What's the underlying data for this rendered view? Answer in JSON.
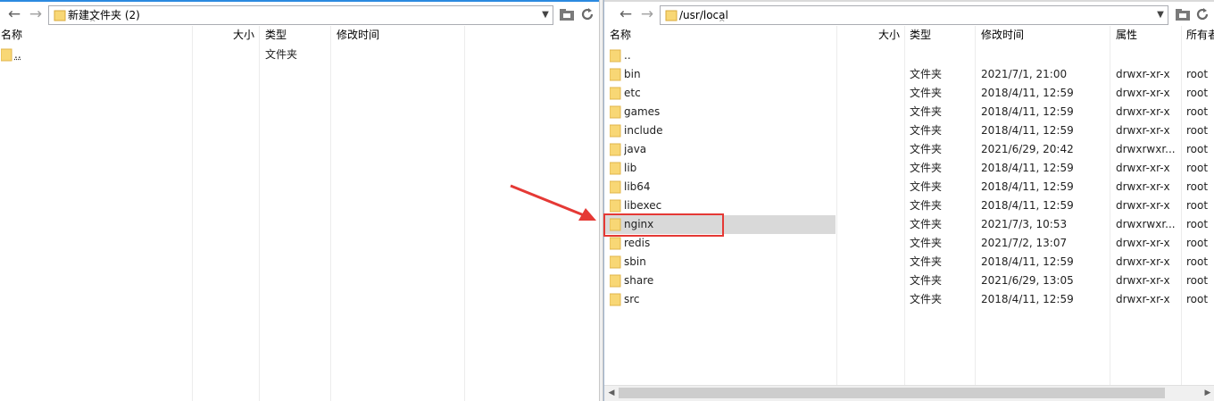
{
  "left_pane": {
    "address": "新建文件夹 (2)",
    "columns": [
      "名称",
      "大小",
      "类型",
      "修改时间"
    ],
    "rows": [
      {
        "name": "..",
        "size": "",
        "type": "文件夹",
        "modified": ""
      }
    ]
  },
  "right_pane": {
    "address": "/usr/local",
    "columns": [
      "名称",
      "大小",
      "类型",
      "修改时间",
      "属性",
      "所有者"
    ],
    "rows": [
      {
        "name": "..",
        "type": "",
        "modified": "",
        "attr": "",
        "owner": ""
      },
      {
        "name": "bin",
        "type": "文件夹",
        "modified": "2021/7/1, 21:00",
        "attr": "drwxr-xr-x",
        "owner": "root"
      },
      {
        "name": "etc",
        "type": "文件夹",
        "modified": "2018/4/11, 12:59",
        "attr": "drwxr-xr-x",
        "owner": "root"
      },
      {
        "name": "games",
        "type": "文件夹",
        "modified": "2018/4/11, 12:59",
        "attr": "drwxr-xr-x",
        "owner": "root"
      },
      {
        "name": "include",
        "type": "文件夹",
        "modified": "2018/4/11, 12:59",
        "attr": "drwxr-xr-x",
        "owner": "root"
      },
      {
        "name": "java",
        "type": "文件夹",
        "modified": "2021/6/29, 20:42",
        "attr": "drwxrwxr...",
        "owner": "root"
      },
      {
        "name": "lib",
        "type": "文件夹",
        "modified": "2018/4/11, 12:59",
        "attr": "drwxr-xr-x",
        "owner": "root"
      },
      {
        "name": "lib64",
        "type": "文件夹",
        "modified": "2018/4/11, 12:59",
        "attr": "drwxr-xr-x",
        "owner": "root"
      },
      {
        "name": "libexec",
        "type": "文件夹",
        "modified": "2018/4/11, 12:59",
        "attr": "drwxr-xr-x",
        "owner": "root"
      },
      {
        "name": "nginx",
        "type": "文件夹",
        "modified": "2021/7/3, 10:53",
        "attr": "drwxrwxr...",
        "owner": "root",
        "selected": true
      },
      {
        "name": "redis",
        "type": "文件夹",
        "modified": "2021/7/2, 13:07",
        "attr": "drwxr-xr-x",
        "owner": "root"
      },
      {
        "name": "sbin",
        "type": "文件夹",
        "modified": "2018/4/11, 12:59",
        "attr": "drwxr-xr-x",
        "owner": "root"
      },
      {
        "name": "share",
        "type": "文件夹",
        "modified": "2021/6/29, 13:05",
        "attr": "drwxr-xr-x",
        "owner": "root"
      },
      {
        "name": "src",
        "type": "文件夹",
        "modified": "2018/4/11, 12:59",
        "attr": "drwxr-xr-x",
        "owner": "root"
      }
    ]
  },
  "icons": {
    "back": "back-arrow-icon",
    "forward": "forward-arrow-icon",
    "folder": "folder-icon",
    "new_folder": "new-folder-icon",
    "refresh": "refresh-icon",
    "dropdown": "chevron-down-icon"
  },
  "colors": {
    "folder": "#f8d775",
    "selection": "#d9d9d9",
    "annotation": "#e53935",
    "pane_border": "#9fb3cc"
  }
}
